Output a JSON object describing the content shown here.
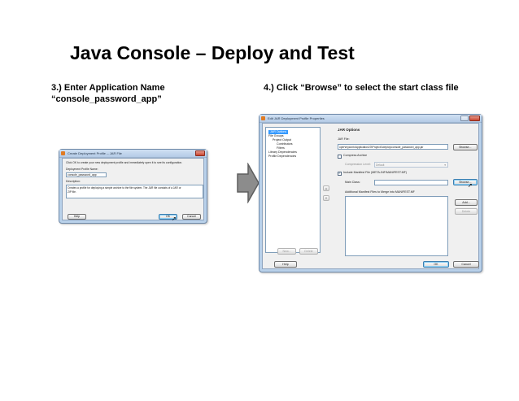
{
  "slide": {
    "title": "Java Console – Deploy and Test",
    "step_left_line1": "3.) Enter Application Name",
    "step_left_line2": "“console_password_app”",
    "step_right": "4.) Click “Browse” to select the start class file"
  },
  "dialog_create": {
    "title": "Create Deployment Profile -- JAR File",
    "instruction": "Click OK to create your new deployment profile and immediately open it to see its configuration.",
    "profile_name_label": "Deployment Profile Name:",
    "profile_name_value": "console_password_app",
    "description_label": "Description:",
    "description_text_line1": "Creates a profile for deploying a simple archive to the file system. The JAR file consists of a JAR or",
    "description_text_line2": "ZIP file.",
    "help_button": "Help",
    "ok_button": "OK",
    "cancel_button": "Cancel"
  },
  "dialog_edit": {
    "title": "Edit JAR Deployment Profile Properties",
    "tree": [
      {
        "label": "JAR Options",
        "level": 0,
        "selected": true
      },
      {
        "label": "File Groups",
        "level": 0,
        "selected": false
      },
      {
        "label": "Project Output",
        "level": 1,
        "selected": false
      },
      {
        "label": "Contributors",
        "level": 2,
        "selected": false
      },
      {
        "label": "Filters",
        "level": 2,
        "selected": false
      },
      {
        "label": "Library Dependencies",
        "level": 0,
        "selected": false
      },
      {
        "label": "Profile Dependencies",
        "level": 0,
        "selected": false
      }
    ],
    "section_title": "JAR Options",
    "jar_file_label": "JAR File:",
    "jar_file_value": "oper\\mywork\\Application23\\Project1\\deploy\\console_password_app.jar",
    "browse_button": "Browse...",
    "compress_label": "Compress Archive",
    "compression_level_label": "Compression Level:",
    "compression_level_value": "Default",
    "include_manifest_label": "Include Manifest File (META-INF/MANIFEST.MF)",
    "main_class_label": "Main Class:",
    "main_class_value": "",
    "browse_button_2": "Browse...",
    "additional_manifest_label": "Additional Manifest Files to Merge into MANIFEST.MF",
    "add_button": "Add...",
    "delete_button": "Delete",
    "new_button": "New...",
    "delete_profile_button": "Delete",
    "help_button": "Help",
    "ok_button": "OK",
    "cancel_button": "Cancel"
  },
  "colors": {
    "window_frame": "#b9d1ea",
    "dialog_body": "#f0f0f0",
    "arrow_fill": "#8c8c8c",
    "arrow_stroke": "#5e5e5e"
  }
}
